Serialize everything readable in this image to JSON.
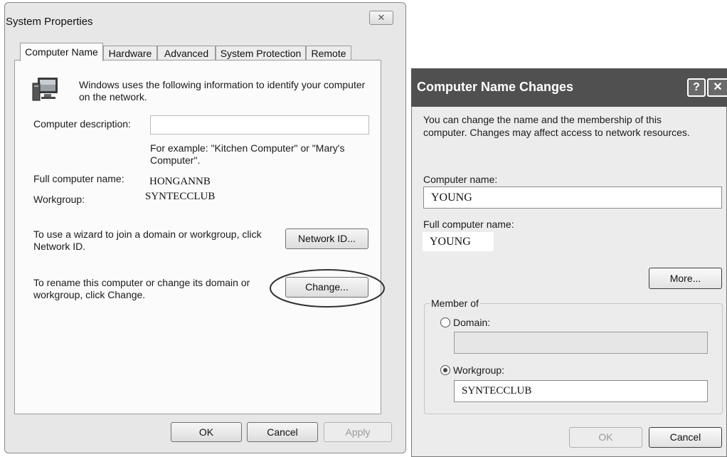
{
  "system_properties": {
    "title": "System Properties",
    "close_glyph": "✕",
    "tabs": [
      "Computer Name",
      "Hardware",
      "Advanced",
      "System Protection",
      "Remote"
    ],
    "info_text": "Windows uses the following information to identify your computer on the network.",
    "info_line1": "Windows uses the following information to identify your computer",
    "info_line2": "on the network.",
    "computer_description_label": "Computer description:",
    "computer_description_value": "",
    "example_line1": "For example: \"Kitchen Computer\" or \"Mary's",
    "example_line2": "Computer\".",
    "full_computer_name_label": "Full computer name:",
    "full_computer_name_value": "HONGANNB",
    "workgroup_label": "Workgroup:",
    "workgroup_value": "SYNTECCLUB",
    "network_text_line1": "To use a wizard to join a domain or workgroup, click",
    "network_text_line2": "Network ID.",
    "network_id_button": "Network ID...",
    "rename_text_line1": "To rename this computer or change its domain or",
    "rename_text_line2": "workgroup, click Change.",
    "change_button": "Change...",
    "ok_button": "OK",
    "cancel_button": "Cancel",
    "apply_button": "Apply"
  },
  "computer_name_changes": {
    "title": "Computer Name Changes",
    "help_glyph": "?",
    "close_glyph": "✕",
    "intro_line1": "You can change the name and the membership of this",
    "intro_line2": "computer. Changes may affect access to network resources.",
    "computer_name_label": "Computer name:",
    "computer_name_value": "YOUNG",
    "full_computer_name_label": "Full computer name:",
    "full_computer_name_value": "YOUNG",
    "more_button": "More...",
    "member_of_label": "Member of",
    "domain_label": "Domain:",
    "domain_value": "",
    "workgroup_label": "Workgroup:",
    "workgroup_value": "SYNTECCLUB",
    "selected_membership": "Workgroup",
    "ok_button": "OK",
    "cancel_button": "Cancel"
  }
}
